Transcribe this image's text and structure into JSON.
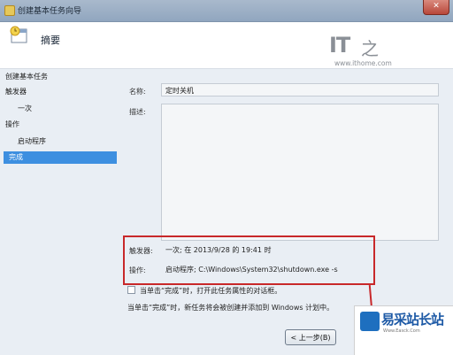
{
  "window": {
    "title": "创建基本任务向导"
  },
  "header": {
    "title": "摘要"
  },
  "logo": {
    "brand": "IT",
    "url": "www.ithome.com"
  },
  "sidebar": {
    "items": [
      {
        "label": "创建基本任务"
      },
      {
        "label": "触发器"
      },
      {
        "label": "一次"
      },
      {
        "label": "操作"
      },
      {
        "label": "启动程序"
      },
      {
        "label": "完成"
      }
    ]
  },
  "form": {
    "name_label": "名称:",
    "name_value": "定时关机",
    "desc_label": "描述:",
    "desc_value": "",
    "trigger_label": "触发器:",
    "trigger_value": "一次; 在 2013/9/28 的 19:41 时",
    "action_label": "操作:",
    "action_value": "启动程序; C:\\Windows\\System32\\shutdown.exe -s"
  },
  "options": {
    "open_properties_label": "当单击“完成”时，打开此任务属性的对话框。",
    "finish_note": "当单击“完成”时，新任务将会被创建并添加到 Windows 计划中。"
  },
  "buttons": {
    "back": "< 上一步(B)"
  },
  "watermark": {
    "text": "易采站长站",
    "sub": "Www.Easck.Com"
  }
}
